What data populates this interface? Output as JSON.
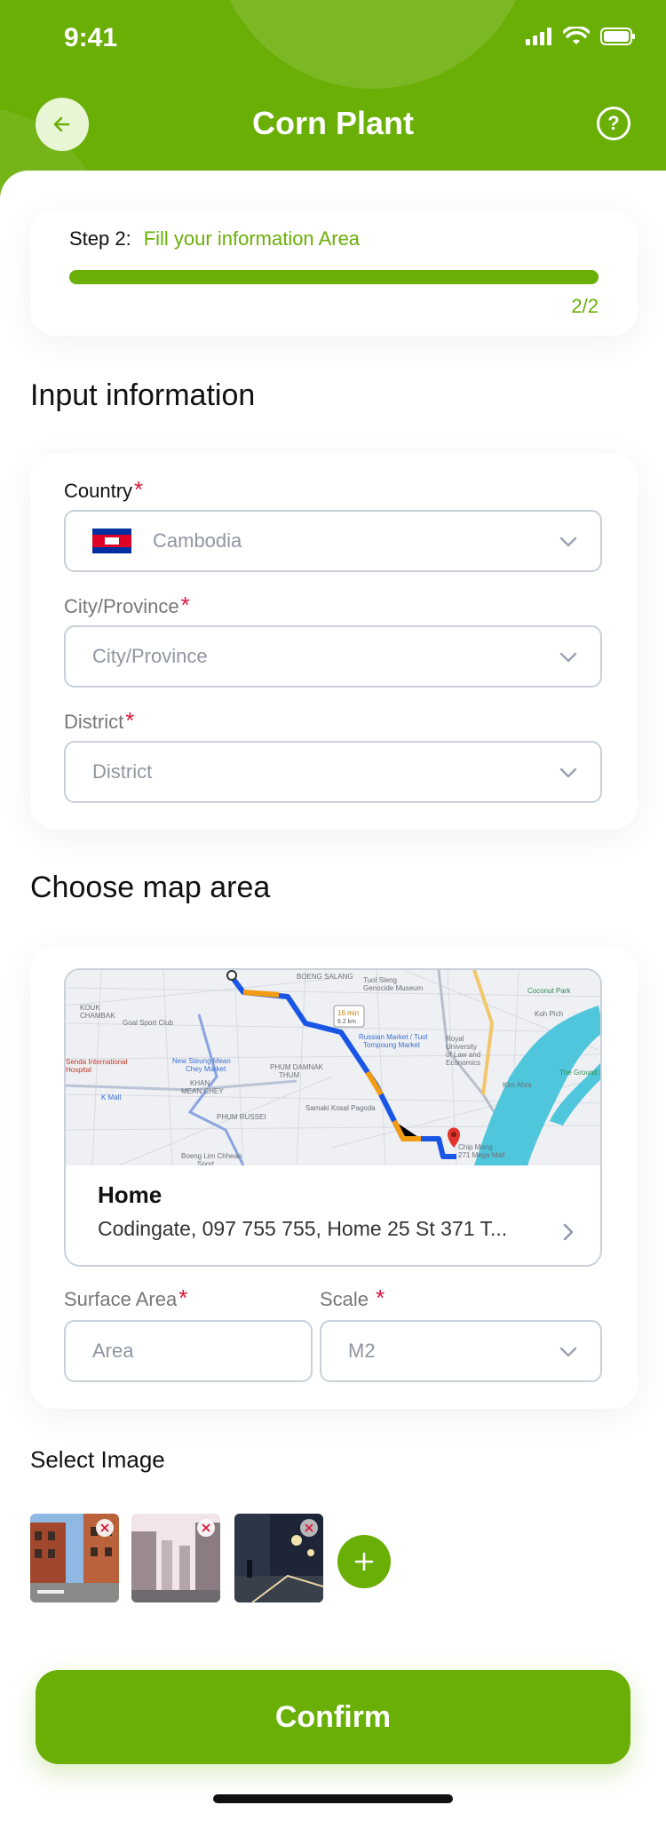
{
  "status_bar": {
    "time": "9:41"
  },
  "header": {
    "title": "Corn Plant"
  },
  "step": {
    "label": "Step 2:",
    "value": "Fill your information Area",
    "count": "2/2",
    "progress": 1.0
  },
  "input_info": {
    "title": "Input information",
    "country": {
      "label": "Country",
      "required": "*",
      "value": "Cambodia"
    },
    "city": {
      "label": "City/Province",
      "required": "*",
      "placeholder": "City/Province"
    },
    "district": {
      "label": "District",
      "required": "*",
      "placeholder": "District"
    }
  },
  "map_section": {
    "title": "Choose map area",
    "place_name": "Home",
    "place_address": "Codingate, 097 755 755, Home 25 St 371 T...",
    "map_labels": [
      "BOENG SALANG",
      "Tuol Sleng Genocide Museum",
      "KOUK CHAMBAK",
      "Goal Sport Club",
      "Senda International Hospital",
      "K Mall",
      "New Steung Mean Chey Market",
      "PHUM DAMNAK THUM",
      "KHAN MEAN CHEY",
      "PHUM RUSSEI",
      "Samaki Kosal Pagoda",
      "Russian Market / Tuol Tompoung Market",
      "Chip Mong 271 Mega Mall",
      "Coconut Park",
      "Koh Pich",
      "The Ground M",
      "Royal University of Law and Economics",
      "16 min",
      "6.2 km",
      "Boeng Lim Chhean Sport",
      "Kim Ahra"
    ],
    "surface_area": {
      "label": "Surface Area",
      "required": "*",
      "placeholder": "Area"
    },
    "scale": {
      "label": "Scale",
      "required": "*",
      "value": "M2"
    }
  },
  "images": {
    "title": "Select Image",
    "count": 3
  },
  "confirm_label": "Confirm",
  "colors": {
    "brand": "#6aaf06",
    "required": "#d9183b",
    "border": "#c9d0db"
  }
}
